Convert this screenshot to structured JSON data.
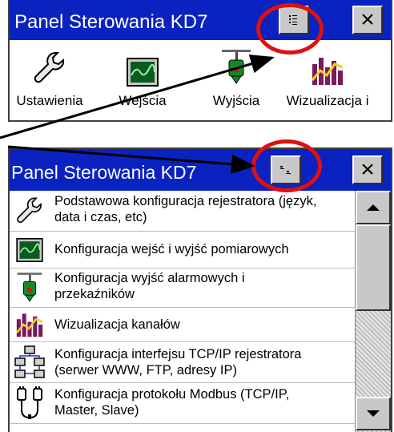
{
  "top_panel": {
    "title": "Panel Sterowania KD7",
    "view_button_icon": "list-view-icon",
    "close_label": "×",
    "icons": [
      {
        "icon": "wrench-icon",
        "label": "Ustawienia"
      },
      {
        "icon": "monitor-wave-icon",
        "label": "Wejścia"
      },
      {
        "icon": "relay-icon",
        "label": "Wyjścia"
      },
      {
        "icon": "bar-chart-icon",
        "label": "Wizualizacja i"
      }
    ]
  },
  "bottom_panel": {
    "title": "Panel Sterowania KD7",
    "view_button_icon": "icon-view-icon",
    "close_label": "×",
    "items": [
      {
        "icon": "wrench-icon",
        "line1": "Podstawowa konfiguracja rejestratora (język,",
        "line2": "data i czas, etc)"
      },
      {
        "icon": "monitor-wave-icon",
        "line1": "Konfiguracja wejść i wyjść pomiarowych",
        "line2": ""
      },
      {
        "icon": "relay-icon",
        "line1": "Konfiguracja wyjść alarmowych i",
        "line2": "przekaźników"
      },
      {
        "icon": "bar-chart-icon",
        "line1": "Wizualizacja kanałów",
        "line2": ""
      },
      {
        "icon": "network-icon",
        "line1": "Konfiguracja interfejsu TCP/IP rejestratora",
        "line2": "(serwer WWW, FTP, adresy IP)"
      },
      {
        "icon": "modbus-icon",
        "line1": "Konfiguracja protokołu Modbus (TCP/IP,",
        "line2": "Master, Slave)"
      }
    ]
  },
  "colors": {
    "titlebar": "#0a22c0",
    "highlight_circle": "#e01010",
    "arrow": "#000000",
    "button_face": "#c8c8c8"
  }
}
